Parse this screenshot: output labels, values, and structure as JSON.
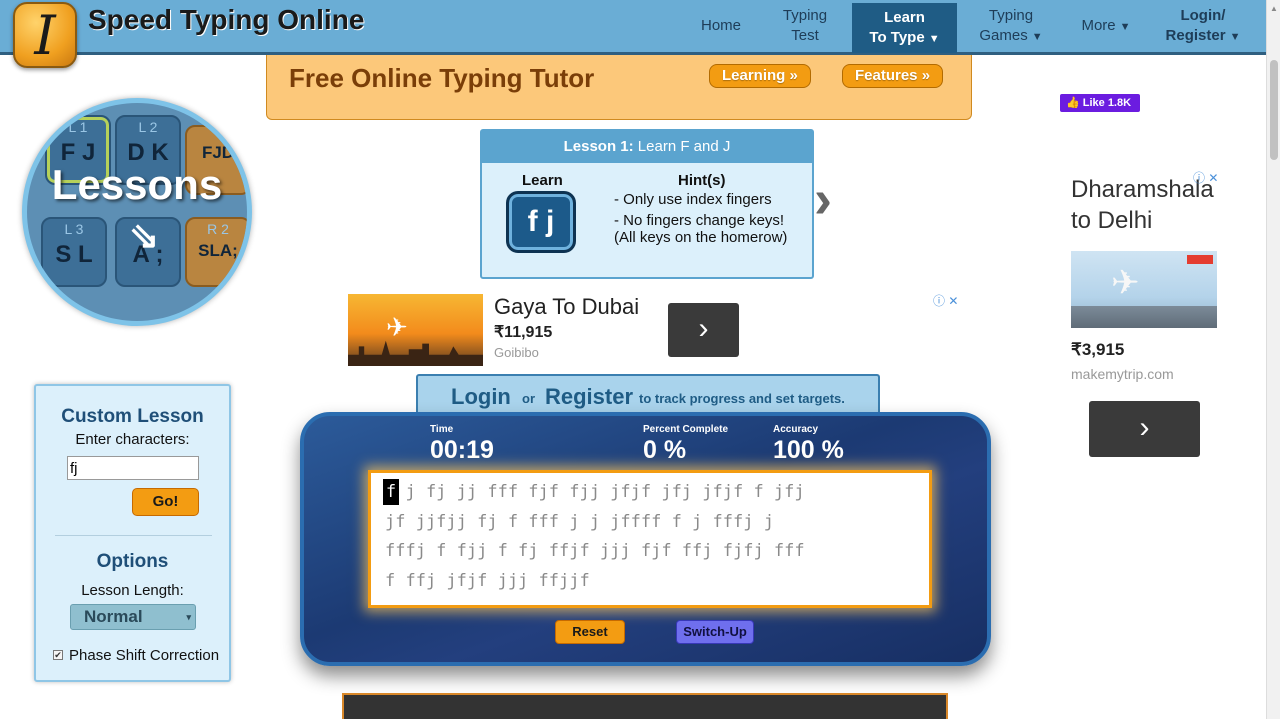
{
  "header": {
    "logo_letter": "I",
    "site_title": "Speed Typing Online",
    "nav": [
      {
        "line1": "Home",
        "line2": "",
        "caret": false,
        "active": false
      },
      {
        "line1": "Typing",
        "line2": "Test",
        "caret": false,
        "active": false
      },
      {
        "line1": "Learn",
        "line2": "To Type",
        "caret": true,
        "active": true
      },
      {
        "line1": "Typing",
        "line2": "Games",
        "caret": true,
        "active": false
      },
      {
        "line1": "More",
        "line2": "",
        "caret": true,
        "active": false
      },
      {
        "line1": "Login/",
        "line2": "Register",
        "caret": true,
        "active": false
      }
    ],
    "caret_glyph": "▼"
  },
  "tutor_banner": {
    "title": "Free Online Typing Tutor",
    "learning_button": "Learning »",
    "features_button": "Features »"
  },
  "lessons_graphic": {
    "word": "Lessons",
    "arrow": "⇘",
    "keys": [
      {
        "label": "L 1",
        "value": "F J"
      },
      {
        "label": "L 2",
        "value": "D K"
      },
      {
        "label": "",
        "value": "FJD"
      },
      {
        "label": "L 3",
        "value": "S L"
      },
      {
        "label": "",
        "value": "A ;"
      },
      {
        "label": "R 2",
        "value": "SLA;"
      }
    ]
  },
  "lesson_card": {
    "heading_bold": "Lesson 1:",
    "heading_rest": " Learn F and J",
    "learn_label": "Learn",
    "learn_key": "f j",
    "hint_title": "Hint(s)",
    "hints": [
      "- Only use index fingers",
      "- No fingers change keys!",
      "(All keys on the homerow)"
    ],
    "next_glyph": "›"
  },
  "ad_middle": {
    "title": "Gaya To Dubai",
    "price": "₹11,915",
    "source": "Goibibo",
    "go_glyph": "›",
    "choice": "ⓘ ✕"
  },
  "login_strip": {
    "login": "Login",
    "or": "or",
    "register": "Register",
    "tail": "to track progress and set targets."
  },
  "typing": {
    "stats": [
      {
        "label": "Time",
        "value": "00:19"
      },
      {
        "label": "Percent Complete",
        "value": "0 %"
      },
      {
        "label": "Accuracy",
        "value": "100 %"
      }
    ],
    "current_char": "f",
    "lines": [
      "  j fj jj fff fjf fjj jfjf jfj jfjf f jfj",
      "jf jjfjj fj f fff j j jffff f j fffj j",
      "fffj f fjj f fj ffjf jjj fjf ffj fjfj fff",
      "f ffj jfjf jjj ffjjf"
    ],
    "reset_button": "Reset",
    "switch_button": "Switch-Up"
  },
  "custom_lesson": {
    "title": "Custom Lesson",
    "subtitle": "Enter characters:",
    "input_value": "fj",
    "go_button": "Go!",
    "options_title": "Options",
    "length_label": "Lesson Length:",
    "length_value": "Normal",
    "select_arrow": "▾",
    "phase_label": "Phase Shift Correction",
    "phase_checked": "✔"
  },
  "right_side": {
    "fb_like": "👍 Like 1.8K",
    "ad_title_line1": "Dharamshala",
    "ad_title_line2": "to Delhi",
    "ad_choice": "ⓘ ✕",
    "plane": "✈",
    "price": "₹3,915",
    "source": "makemytrip.com",
    "go_glyph": "›"
  }
}
